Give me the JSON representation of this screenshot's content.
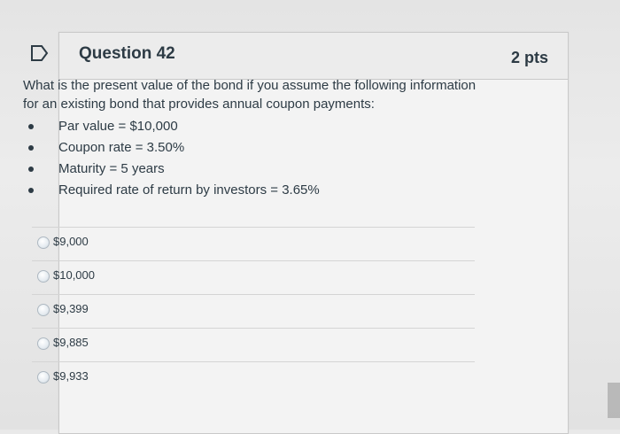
{
  "question": {
    "title": "Question 42",
    "points": "2 pts",
    "text": "What is the present value of the bond if you assume the following information for an existing bond that provides annual coupon payments:",
    "details": [
      "Par value = $10,000",
      "Coupon rate = 3.50%",
      "Maturity = 5 years",
      "Required rate of return by investors = 3.65%"
    ]
  },
  "answers": [
    {
      "label": "$9,000",
      "selected": false
    },
    {
      "label": "$10,000",
      "selected": false
    },
    {
      "label": "$9,399",
      "selected": false
    },
    {
      "label": "$9,885",
      "selected": false
    },
    {
      "label": "$9,933",
      "selected": false
    }
  ],
  "icons": {
    "flag": "flag-icon"
  },
  "colors": {
    "text": "#2d3b45",
    "border": "#c9c9c9",
    "background": "#f3f3f3"
  }
}
